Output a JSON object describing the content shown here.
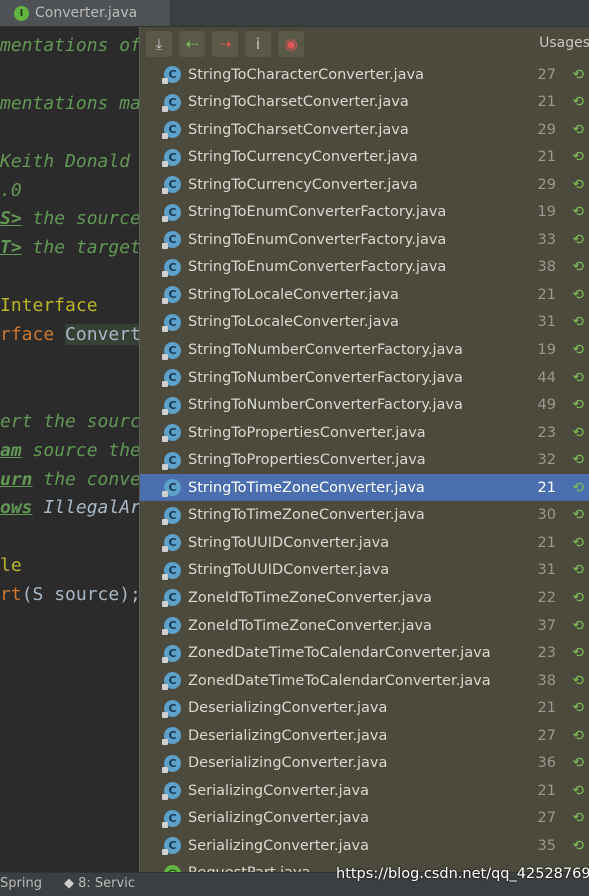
{
  "editor": {
    "tab_label": "Converter.java",
    "tab_icon": "interface-file-icon",
    "code_lines": [
      {
        "parts": [
          {
            "t": "mentations of",
            "c": "c-doc"
          }
        ]
      },
      {
        "parts": []
      },
      {
        "parts": [
          {
            "t": "mentations ma",
            "c": "c-doc"
          }
        ]
      },
      {
        "parts": []
      },
      {
        "parts": [
          {
            "t": "Keith Donald",
            "c": "c-doc"
          }
        ]
      },
      {
        "parts": [
          {
            "t": ".0",
            "c": "c-doc"
          }
        ]
      },
      {
        "parts": [
          {
            "t": "S>",
            "c": "c-tag"
          },
          {
            "t": " the source",
            "c": "c-doc"
          }
        ]
      },
      {
        "parts": [
          {
            "t": "T>",
            "c": "c-tag"
          },
          {
            "t": " the target",
            "c": "c-doc"
          }
        ]
      },
      {
        "parts": []
      },
      {
        "parts": [
          {
            "t": "Interface",
            "c": "c-ann"
          }
        ]
      },
      {
        "parts": [
          {
            "t": "rface ",
            "c": "c-kw"
          },
          {
            "t": "Convert",
            "c": "c-cls"
          }
        ]
      },
      {
        "parts": []
      },
      {
        "parts": []
      },
      {
        "parts": [
          {
            "t": "ert the sourc",
            "c": "c-doc"
          }
        ]
      },
      {
        "parts": [
          {
            "t": "am",
            "c": "c-tag"
          },
          {
            "t": " source the",
            "c": "c-doc"
          }
        ]
      },
      {
        "parts": [
          {
            "t": "urn",
            "c": "c-tag"
          },
          {
            "t": " the conve",
            "c": "c-doc"
          }
        ]
      },
      {
        "parts": [
          {
            "t": "ows",
            "c": "c-tag"
          },
          {
            "t": " IllegalAr",
            "c": "c-it"
          }
        ]
      },
      {
        "parts": []
      },
      {
        "parts": [
          {
            "t": "le",
            "c": "c-ann"
          }
        ]
      },
      {
        "parts": [
          {
            "t": "rt",
            "c": "c-kw"
          },
          {
            "t": "(S source);",
            "c": "c-txt"
          }
        ]
      }
    ]
  },
  "usages_popup": {
    "title": "Usages",
    "toolbar": [
      {
        "name": "collapse-all-icon",
        "glyph": "⤓"
      },
      {
        "name": "previous-occurrence-icon",
        "glyph": "⇠"
      },
      {
        "name": "next-occurrence-icon",
        "glyph": "⇢"
      },
      {
        "name": "info-icon",
        "glyph": "i"
      },
      {
        "name": "pin-icon",
        "glyph": "◉"
      }
    ],
    "selected_index": 15,
    "rows": [
      {
        "file": "StringToCharacterConverter.java",
        "line": "27",
        "icon": "C"
      },
      {
        "file": "StringToCharsetConverter.java",
        "line": "21",
        "icon": "C"
      },
      {
        "file": "StringToCharsetConverter.java",
        "line": "29",
        "icon": "C"
      },
      {
        "file": "StringToCurrencyConverter.java",
        "line": "21",
        "icon": "C"
      },
      {
        "file": "StringToCurrencyConverter.java",
        "line": "29",
        "icon": "C"
      },
      {
        "file": "StringToEnumConverterFactory.java",
        "line": "19",
        "icon": "C"
      },
      {
        "file": "StringToEnumConverterFactory.java",
        "line": "33",
        "icon": "C"
      },
      {
        "file": "StringToEnumConverterFactory.java",
        "line": "38",
        "icon": "C"
      },
      {
        "file": "StringToLocaleConverter.java",
        "line": "21",
        "icon": "C"
      },
      {
        "file": "StringToLocaleConverter.java",
        "line": "31",
        "icon": "C"
      },
      {
        "file": "StringToNumberConverterFactory.java",
        "line": "19",
        "icon": "C"
      },
      {
        "file": "StringToNumberConverterFactory.java",
        "line": "44",
        "icon": "C"
      },
      {
        "file": "StringToNumberConverterFactory.java",
        "line": "49",
        "icon": "C"
      },
      {
        "file": "StringToPropertiesConverter.java",
        "line": "23",
        "icon": "C"
      },
      {
        "file": "StringToPropertiesConverter.java",
        "line": "32",
        "icon": "C"
      },
      {
        "file": "StringToTimeZoneConverter.java",
        "line": "21",
        "icon": "C"
      },
      {
        "file": "StringToTimeZoneConverter.java",
        "line": "30",
        "icon": "C"
      },
      {
        "file": "StringToUUIDConverter.java",
        "line": "21",
        "icon": "C"
      },
      {
        "file": "StringToUUIDConverter.java",
        "line": "31",
        "icon": "C"
      },
      {
        "file": "ZoneIdToTimeZoneConverter.java",
        "line": "22",
        "icon": "C"
      },
      {
        "file": "ZoneIdToTimeZoneConverter.java",
        "line": "37",
        "icon": "C"
      },
      {
        "file": "ZonedDateTimeToCalendarConverter.java",
        "line": "23",
        "icon": "C"
      },
      {
        "file": "ZonedDateTimeToCalendarConverter.java",
        "line": "38",
        "icon": "C"
      },
      {
        "file": "DeserializingConverter.java",
        "line": "21",
        "icon": "C"
      },
      {
        "file": "DeserializingConverter.java",
        "line": "27",
        "icon": "C"
      },
      {
        "file": "DeserializingConverter.java",
        "line": "36",
        "icon": "C"
      },
      {
        "file": "SerializingConverter.java",
        "line": "21",
        "icon": "C"
      },
      {
        "file": "SerializingConverter.java",
        "line": "27",
        "icon": "C"
      },
      {
        "file": "SerializingConverter.java",
        "line": "35",
        "icon": "C"
      },
      {
        "file": "RequestPart.java",
        "line": "",
        "icon": "@"
      }
    ]
  },
  "statusbar": {
    "spring_label": "Spring",
    "services_label": "8: Servic"
  },
  "watermark": "https://blog.csdn.net/qq_42528769"
}
